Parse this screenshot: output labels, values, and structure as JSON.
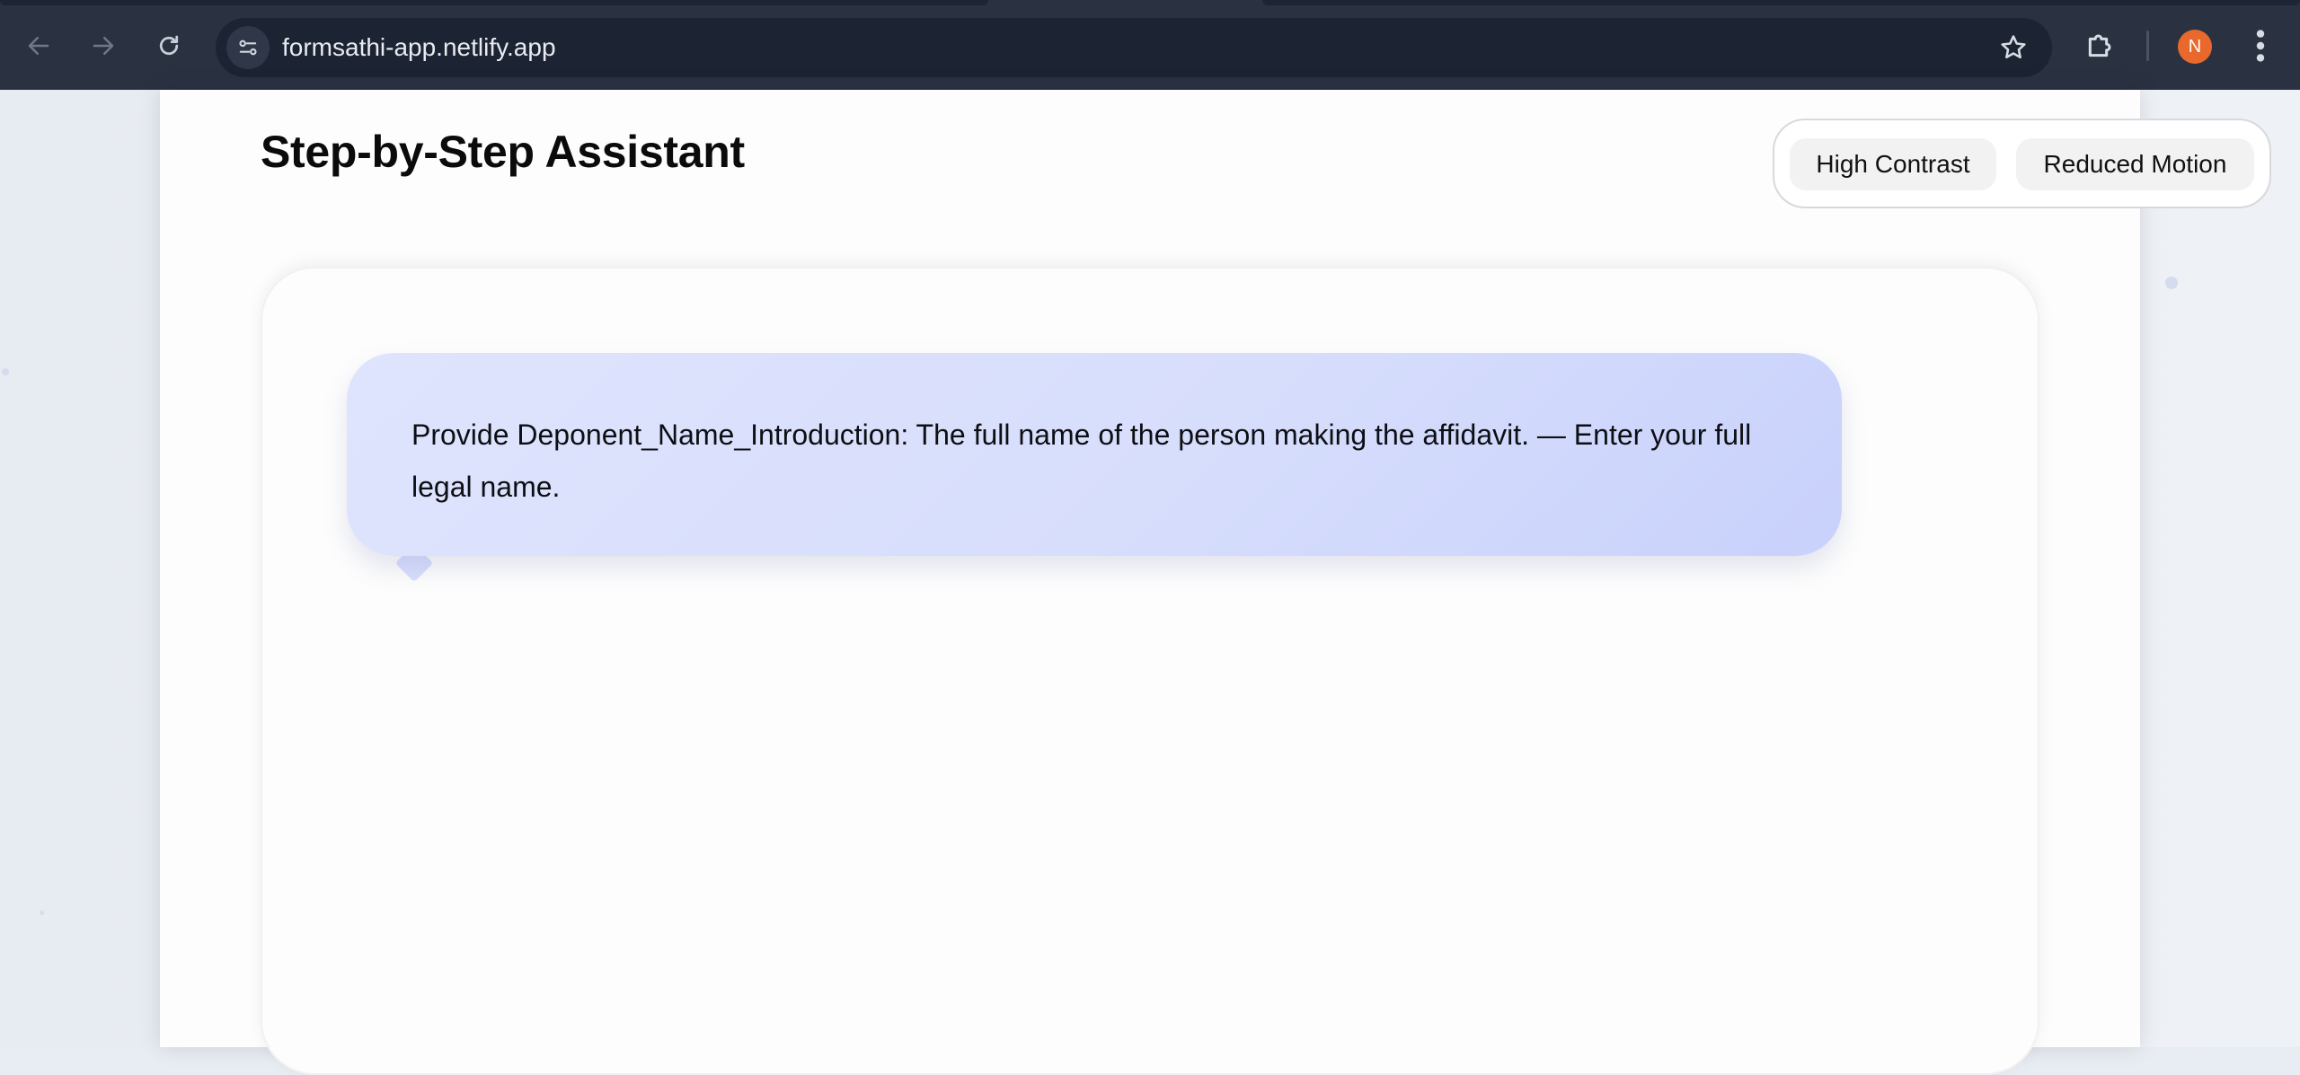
{
  "browser": {
    "url": "formsathi-app.netlify.app",
    "profile_initial": "N",
    "icons": {
      "back": "back-arrow-icon",
      "forward": "forward-arrow-icon",
      "reload": "reload-icon",
      "site_info": "site-settings-icon",
      "bookmark": "star-icon",
      "extensions": "puzzle-icon",
      "menu": "kebab-menu-icon"
    },
    "colors": {
      "chrome_bg": "#2a3242",
      "omnibox_bg": "#1c2333",
      "avatar": "#e8692b"
    }
  },
  "header": {
    "title": "Step-by-Step Assistant"
  },
  "accessibility": {
    "high_contrast_label": "High Contrast",
    "reduced_motion_label": "Reduced Motion"
  },
  "assistant": {
    "prompt": "Provide Deponent_Name_Introduction: The full name of the person making the affidavit. — Enter your full legal name.",
    "bubble_color": "#d7defc"
  }
}
